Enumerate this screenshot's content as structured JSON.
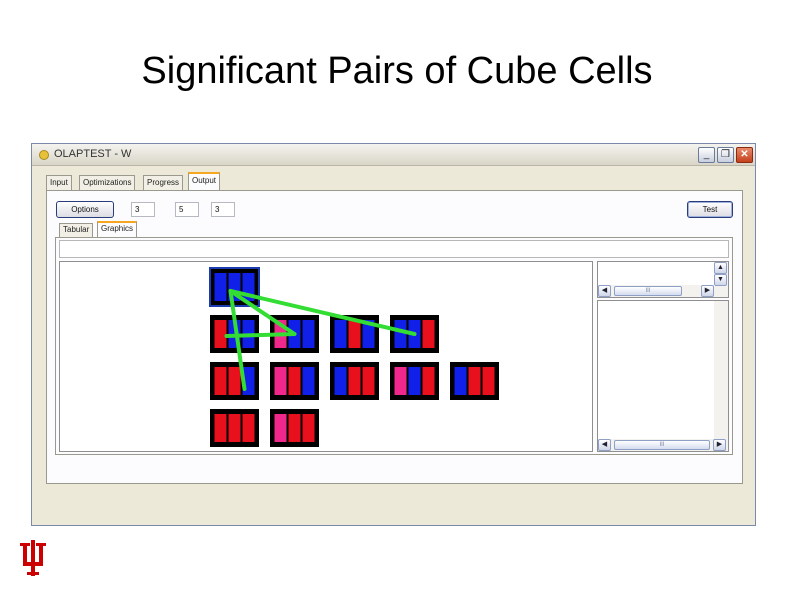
{
  "slide": {
    "title": "Significant Pairs of Cube Cells"
  },
  "window": {
    "title": "OLAPTEST - W",
    "controls": {
      "minimize": "_",
      "maximize": "❐",
      "close": "✕"
    }
  },
  "tabs": [
    {
      "label": "Input",
      "active": false
    },
    {
      "label": "Optimizations",
      "active": false
    },
    {
      "label": "Progress",
      "active": false
    },
    {
      "label": "Output",
      "active": true
    }
  ],
  "toolbar": {
    "options_label": "Options",
    "field1_value": "3",
    "field2_value": "5",
    "field3_value": "3",
    "test_label": "Test"
  },
  "subtabs": [
    {
      "label": "Tabular",
      "active": false
    },
    {
      "label": "Graphics",
      "active": true
    }
  ],
  "scrollbars": {
    "up_arrow": "▲",
    "down_arrow": "▼",
    "left_arrow": "◀",
    "right_arrow": "▶",
    "grip": "III"
  },
  "colors": {
    "cell_border": "#000000",
    "blue": "#1020e8",
    "red": "#e8101c",
    "pink": "#f0288c",
    "link": "#33dd33",
    "highlight": "#1a3cb0"
  },
  "cube_cells": [
    {
      "row": 0,
      "col": 0,
      "bars": [
        "blue",
        "blue",
        "blue"
      ],
      "highlighted": true
    },
    {
      "row": 1,
      "col": 0,
      "bars": [
        "red",
        "blue",
        "blue"
      ]
    },
    {
      "row": 1,
      "col": 1,
      "bars": [
        "pink",
        "blue",
        "blue"
      ]
    },
    {
      "row": 1,
      "col": 2,
      "bars": [
        "blue",
        "red",
        "blue"
      ]
    },
    {
      "row": 1,
      "col": 3,
      "bars": [
        "blue",
        "blue",
        "red"
      ]
    },
    {
      "row": 2,
      "col": 0,
      "bars": [
        "red",
        "red",
        "blue"
      ]
    },
    {
      "row": 2,
      "col": 1,
      "bars": [
        "pink",
        "red",
        "blue"
      ]
    },
    {
      "row": 2,
      "col": 2,
      "bars": [
        "blue",
        "red",
        "red"
      ]
    },
    {
      "row": 2,
      "col": 3,
      "bars": [
        "pink",
        "blue",
        "red"
      ]
    },
    {
      "row": 2,
      "col": 4,
      "bars": [
        "blue",
        "red",
        "red"
      ]
    },
    {
      "row": 3,
      "col": 0,
      "bars": [
        "red",
        "red",
        "red"
      ]
    },
    {
      "row": 3,
      "col": 1,
      "bars": [
        "pink",
        "red",
        "red"
      ]
    }
  ],
  "links": [
    {
      "from": 0,
      "to": 2
    },
    {
      "from": 0,
      "to": 4
    },
    {
      "from": 0,
      "to": 6
    },
    {
      "from": 1,
      "to": 2
    }
  ]
}
